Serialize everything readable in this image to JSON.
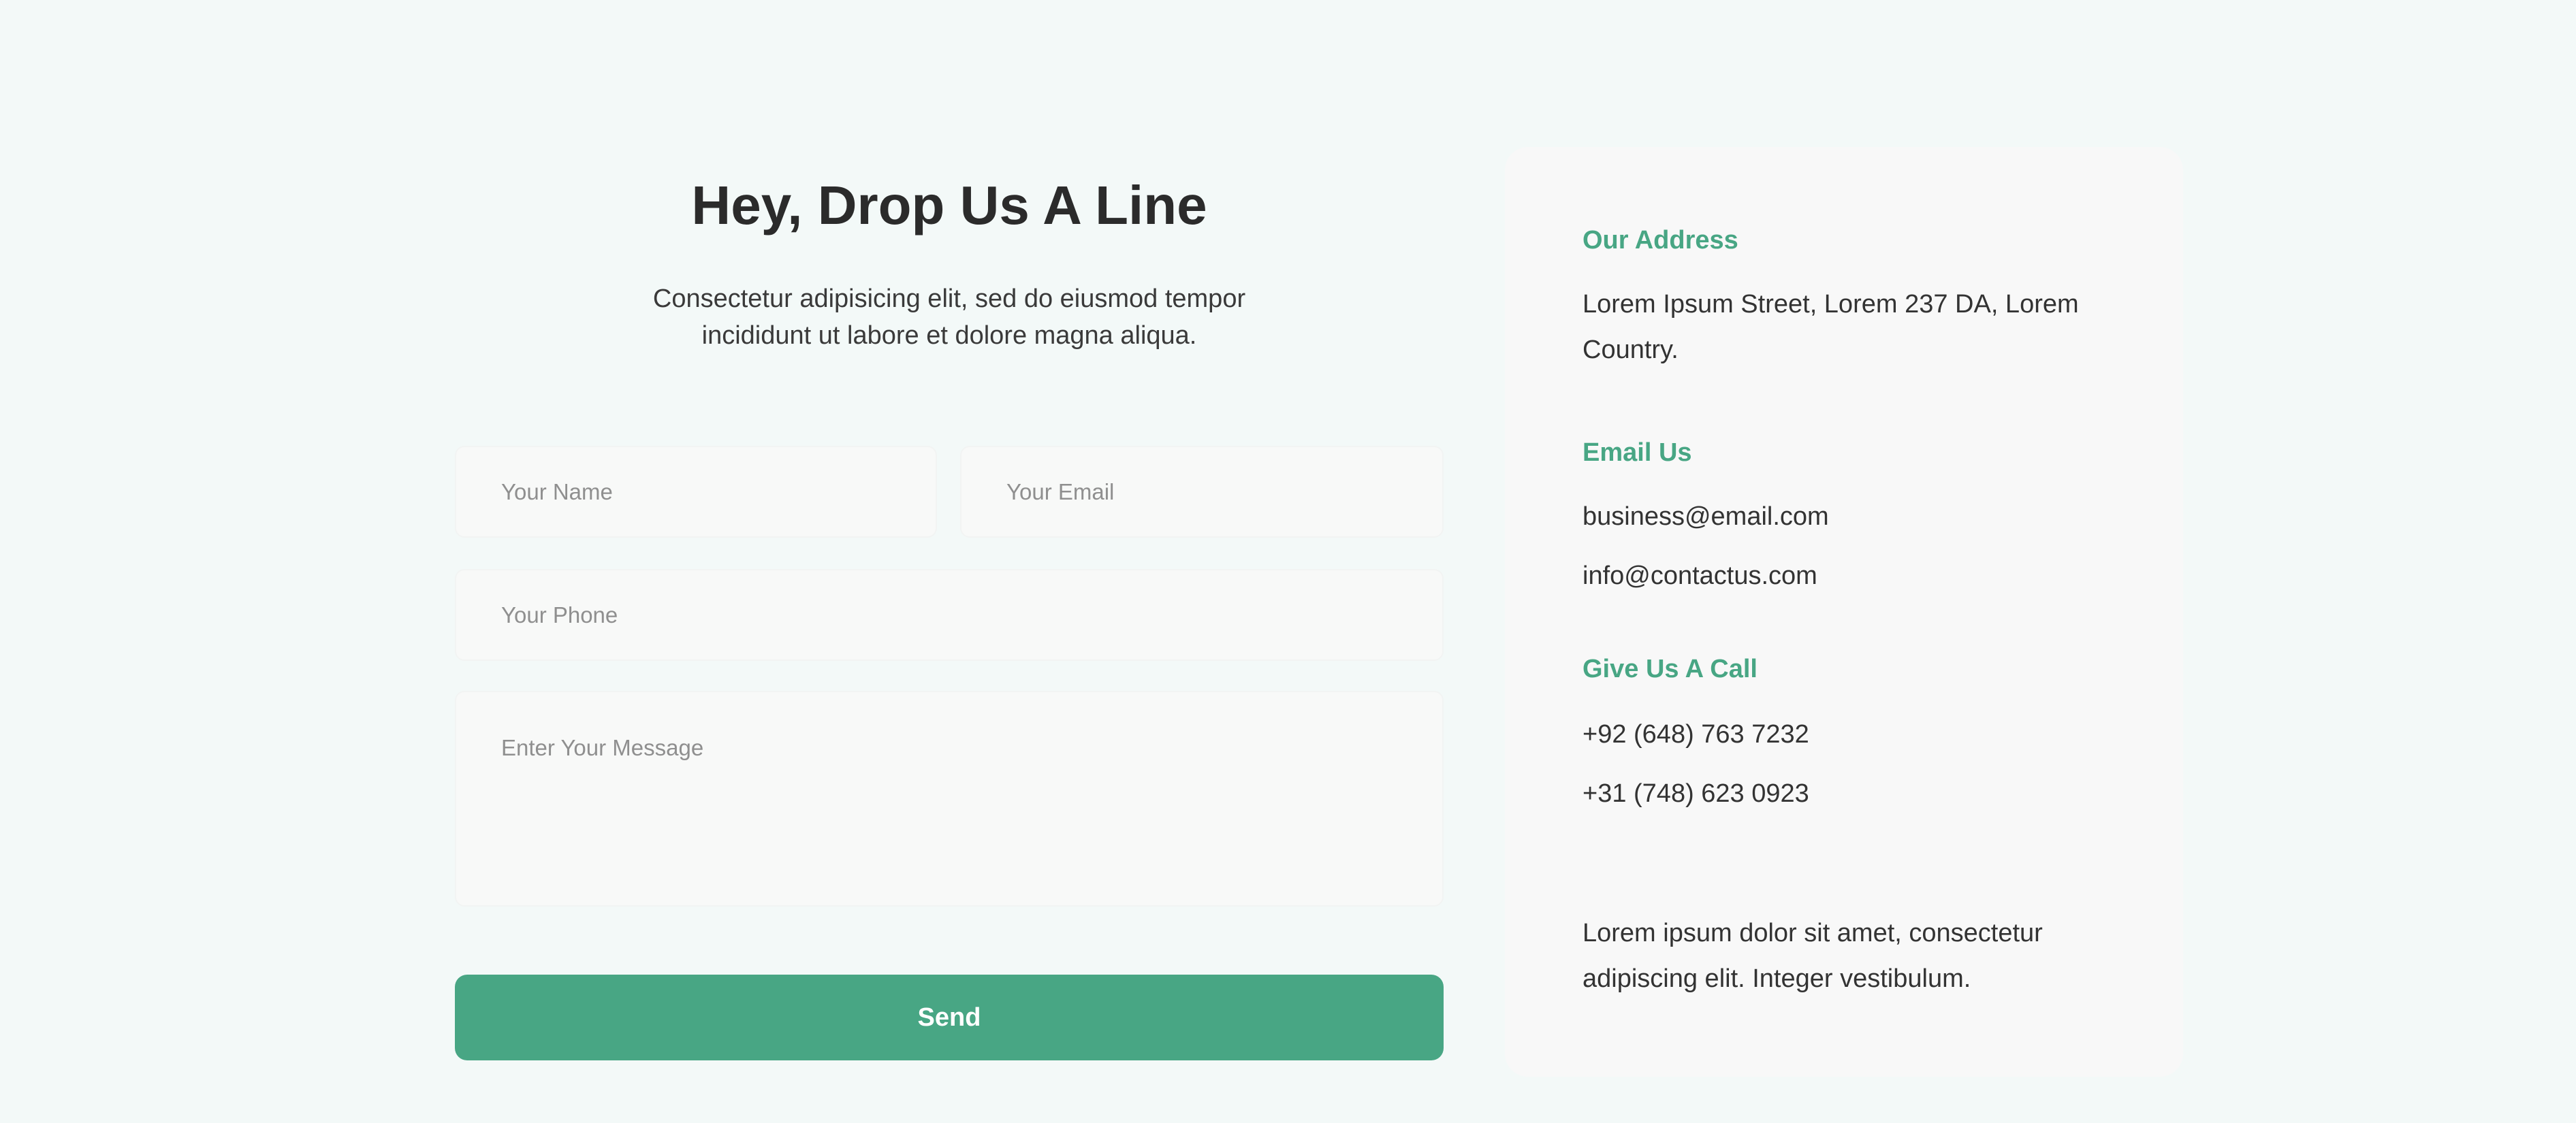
{
  "form": {
    "title": "Hey, Drop Us A Line",
    "subtitle": "Consectetur adipisicing elit, sed do eiusmod tempor incididunt ut labore et dolore magna aliqua.",
    "name_placeholder": "Your Name",
    "email_placeholder": "Your Email",
    "phone_placeholder": "Your Phone",
    "message_placeholder": "Enter Your Message",
    "send_label": "Send"
  },
  "info": {
    "address_heading": "Our Address",
    "address_text": "Lorem Ipsum Street, Lorem 237 DA, Lorem Country.",
    "email_heading": "Email Us",
    "email_1": "business@email.com",
    "email_2": "info@contactus.com",
    "call_heading": "Give Us A Call",
    "phone_1": "+92 (648) 763 7232",
    "phone_2": "+31 (748) 623 0923",
    "note": "Lorem ipsum dolor sit amet, consectetur adipiscing elit. Integer vestibulum."
  },
  "colors": {
    "page_background": "#f3f9f8",
    "accent": "#48a684",
    "card_background": "#f8f8f8",
    "text": "#2b2b2b"
  }
}
